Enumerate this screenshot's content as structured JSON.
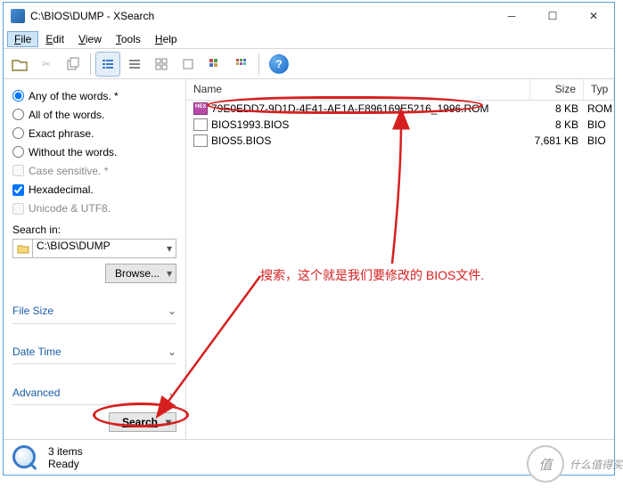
{
  "window": {
    "title": "C:\\BIOS\\DUMP - XSearch"
  },
  "menu": {
    "file": "File",
    "edit": "Edit",
    "view": "View",
    "tools": "Tools",
    "help": "Help"
  },
  "sidebar": {
    "radios": {
      "any": "Any of the words. *",
      "all": "All of the words.",
      "exact": "Exact phrase.",
      "without": "Without the words."
    },
    "checks": {
      "case": "Case sensitive. *",
      "hex": "Hexadecimal.",
      "unicode": "Unicode & UTF8."
    },
    "search_in_label": "Search in:",
    "path": "C:\\BIOS\\DUMP",
    "browse": "Browse...",
    "sections": {
      "filesize": "File Size",
      "datetime": "Date Time",
      "advanced": "Advanced"
    },
    "search_btn": "Search"
  },
  "list": {
    "headers": {
      "name": "Name",
      "size": "Size",
      "type": "Typ"
    },
    "rows": [
      {
        "icon": "hex",
        "name": "79E0EDD7-9D1D-4F41-AE1A-F896169E5216_1996.ROM",
        "size": "8 KB",
        "type": "ROM"
      },
      {
        "icon": "file",
        "name": "BIOS1993.BIOS",
        "size": "8 KB",
        "type": "BIO"
      },
      {
        "icon": "file",
        "name": "BIOS5.BIOS",
        "size": "7,681 KB",
        "type": "BIO"
      }
    ]
  },
  "status": {
    "count": "3 items",
    "state": "Ready"
  },
  "annotation": {
    "text": "搜索，这个就是我们要修改的 BIOS文件."
  },
  "watermark": {
    "char": "值",
    "text": "什么值得买"
  },
  "colors": {
    "accent": "#1a5ca8",
    "anno": "#d62020"
  }
}
